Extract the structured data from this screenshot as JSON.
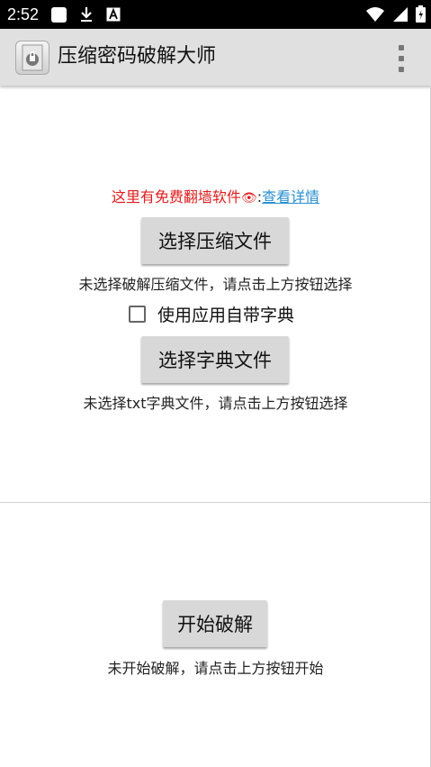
{
  "status_bar": {
    "time": "2:52",
    "icons_left": [
      "square-notification-icon",
      "download-icon",
      "keyboard-a-icon"
    ],
    "icons_right": [
      "wifi-icon",
      "signal-icon",
      "battery-icon"
    ]
  },
  "app_bar": {
    "title": "压缩密码破解大师",
    "icon": "zip-lock-app-icon",
    "menu_icon": "overflow-menu-icon"
  },
  "promo": {
    "text": "这里有免费翻墙软件",
    "eye_glyph": "👁",
    "separator": ":",
    "link": "查看详情"
  },
  "archive": {
    "button_label": "选择压缩文件",
    "hint": "未选择破解压缩文件，请点击上方按钮选择"
  },
  "builtin_dict": {
    "label": "使用应用自带字典",
    "checked": false
  },
  "dictionary": {
    "button_label": "选择字典文件",
    "hint": "未选择txt字典文件，请点击上方按钮选择"
  },
  "crack": {
    "button_label": "开始破解",
    "hint": "未开始破解，请点击上方按钮开始"
  }
}
